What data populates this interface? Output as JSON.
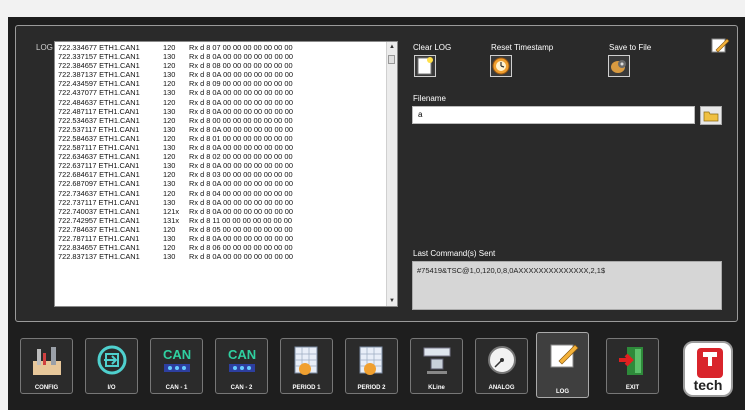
{
  "log": {
    "label": "LOG",
    "lines": [
      [
        "722.334677 ETH1.CAN1",
        "120",
        "Rx d 8 07 00 00 00 00 00 00 00"
      ],
      [
        "722.337157 ETH1.CAN1",
        "130",
        "Rx d 8 0A 00 00 00 00 00 00 00"
      ],
      [
        "722.384657 ETH1.CAN1",
        "120",
        "Rx d 8 08 00 00 00 00 00 00 00"
      ],
      [
        "722.387137 ETH1.CAN1",
        "130",
        "Rx d 8 0A 00 00 00 00 00 00 00"
      ],
      [
        "722.434597 ETH1.CAN1",
        "120",
        "Rx d 8 09 00 00 00 00 00 00 00"
      ],
      [
        "722.437077 ETH1.CAN1",
        "130",
        "Rx d 8 0A 00 00 00 00 00 00 00"
      ],
      [
        "722.484637 ETH1.CAN1",
        "120",
        "Rx d 8 0A 00 00 00 00 00 00 00"
      ],
      [
        "722.487117 ETH1.CAN1",
        "130",
        "Rx d 8 0A 00 00 00 00 00 00 00"
      ],
      [
        "722.534637 ETH1.CAN1",
        "120",
        "Rx d 8 00 00 00 00 00 00 00 00"
      ],
      [
        "722.537117 ETH1.CAN1",
        "130",
        "Rx d 8 0A 00 00 00 00 00 00 00"
      ],
      [
        "722.584637 ETH1.CAN1",
        "120",
        "Rx d 8 01 00 00 00 00 00 00 00"
      ],
      [
        "722.587117 ETH1.CAN1",
        "130",
        "Rx d 8 0A 00 00 00 00 00 00 00"
      ],
      [
        "722.634637 ETH1.CAN1",
        "120",
        "Rx d 8 02 00 00 00 00 00 00 00"
      ],
      [
        "722.637117 ETH1.CAN1",
        "130",
        "Rx d 8 0A 00 00 00 00 00 00 00"
      ],
      [
        "722.684617 ETH1.CAN1",
        "120",
        "Rx d 8 03 00 00 00 00 00 00 00"
      ],
      [
        "722.687097 ETH1.CAN1",
        "130",
        "Rx d 8 0A 00 00 00 00 00 00 00"
      ],
      [
        "722.734637 ETH1.CAN1",
        "120",
        "Rx d 8 04 00 00 00 00 00 00 00"
      ],
      [
        "722.737117 ETH1.CAN1",
        "130",
        "Rx d 8 0A 00 00 00 00 00 00 00"
      ],
      [
        "722.740037 ETH1.CAN1",
        "121x",
        "Rx d 8 0A 00 00 00 00 00 00 00"
      ],
      [
        "722.742957 ETH1.CAN1",
        "131x",
        "Rx d 8 11 00 00 00 00 00 00 00"
      ],
      [
        "722.784637 ETH1.CAN1",
        "120",
        "Rx d 8 05 00 00 00 00 00 00 00"
      ],
      [
        "722.787117 ETH1.CAN1",
        "130",
        "Rx d 8 0A 00 00 00 00 00 00 00"
      ],
      [
        "722.834657 ETH1.CAN1",
        "120",
        "Rx d 8 06 00 00 00 00 00 00 00"
      ],
      [
        "722.837137 ETH1.CAN1",
        "130",
        "Rx d 8 0A 00 00 00 00 00 00 00"
      ]
    ]
  },
  "actions": {
    "clear_label": "Clear LOG",
    "reset_label": "Reset Timestamp",
    "save_label": "Save to File"
  },
  "filename": {
    "label": "Filename",
    "value": "a"
  },
  "last_command": {
    "label": "Last Command(s) Sent",
    "value": "#75419&TSC@1,0,120,0,8,0AXXXXXXXXXXXXXX,2,1$"
  },
  "toolbar": {
    "config": "CONFIG",
    "io": "I/O",
    "can1": "CAN - 1",
    "can2": "CAN - 2",
    "period1": "PERIOD 1",
    "period2": "PERIOD 2",
    "kline": "KLine",
    "analog": "ANALOG",
    "log": "LOG",
    "exit": "EXIT"
  },
  "logo": {
    "text": "tech"
  }
}
